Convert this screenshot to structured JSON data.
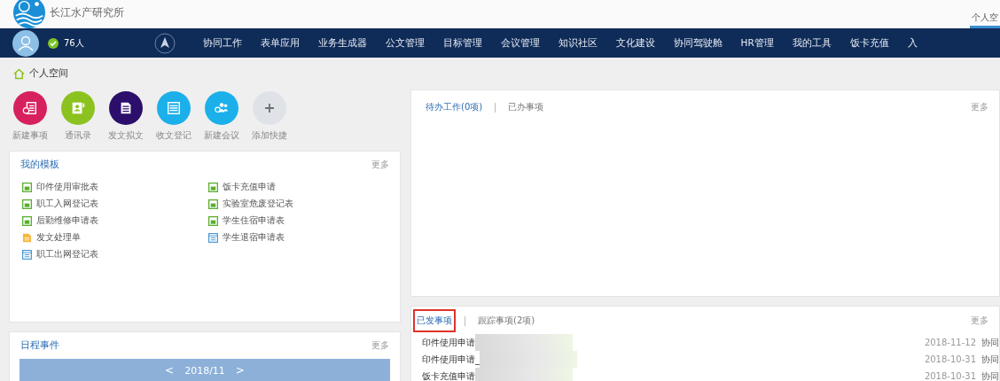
{
  "header": {
    "org_name": "长江水产研究所",
    "tabs": [
      {
        "label": "个人空",
        "selected": true
      }
    ]
  },
  "navbar": {
    "online_count": "76人",
    "online": true,
    "items": [
      "协同工作",
      "表单应用",
      "业务生成器",
      "公文管理",
      "目标管理",
      "会议管理",
      "知识社区",
      "文化建设",
      "协同驾驶舱",
      "HR管理",
      "我的工具",
      "饭卡充值",
      "入"
    ]
  },
  "breadcrumb": "个人空间",
  "shortcuts": [
    {
      "label": "新建事项",
      "kind": "new-item",
      "color": "#d6215e"
    },
    {
      "label": "通讯录",
      "kind": "contacts",
      "color": "#8cc21f"
    },
    {
      "label": "发文拟文",
      "kind": "draft",
      "color": "#2c0e6b"
    },
    {
      "label": "收文登记",
      "kind": "register",
      "color": "#1cb0ea"
    },
    {
      "label": "新建会议",
      "kind": "meeting",
      "color": "#1cb0ea"
    },
    {
      "label": "添加快捷",
      "kind": "add",
      "color": "#dfe3e8"
    }
  ],
  "templates": {
    "title": "我的模板",
    "more": "更多",
    "items": [
      {
        "label": "印件使用审批表",
        "kind": "form"
      },
      {
        "label": "饭卡充值申请",
        "kind": "form"
      },
      {
        "label": "职工入网登记表",
        "kind": "form"
      },
      {
        "label": "实验室危废登记表",
        "kind": "form"
      },
      {
        "label": "后勤维修申请表",
        "kind": "form"
      },
      {
        "label": "学生住宿申请表",
        "kind": "form"
      },
      {
        "label": "发文处理单",
        "kind": "document"
      },
      {
        "label": "学生退宿申请表",
        "kind": "list"
      },
      {
        "label": "职工出网登记表",
        "kind": "list"
      }
    ]
  },
  "schedule": {
    "title": "日程事件",
    "more": "更多",
    "prev": "<",
    "month": "2018/11",
    "next": ">"
  },
  "pending": {
    "tabs": [
      {
        "label": "待办工作(0项)",
        "selected": true
      },
      {
        "label": "已办事项",
        "selected": false
      }
    ],
    "more": "更多"
  },
  "sent": {
    "tabs": [
      {
        "label": "已发事项",
        "selected": true,
        "highlighted": true
      },
      {
        "label": "跟踪事项(2项)",
        "selected": false,
        "highlighted": false
      }
    ],
    "more": "更多",
    "rows": [
      {
        "title": "印件使用申请",
        "date": "2018-11-12",
        "type": "协同"
      },
      {
        "title": "印件使用申请_",
        "date": "2018-10-31",
        "type": "协同"
      },
      {
        "title": "饭卡充值申请",
        "date": "2018-10-31",
        "type": "协同"
      }
    ]
  }
}
